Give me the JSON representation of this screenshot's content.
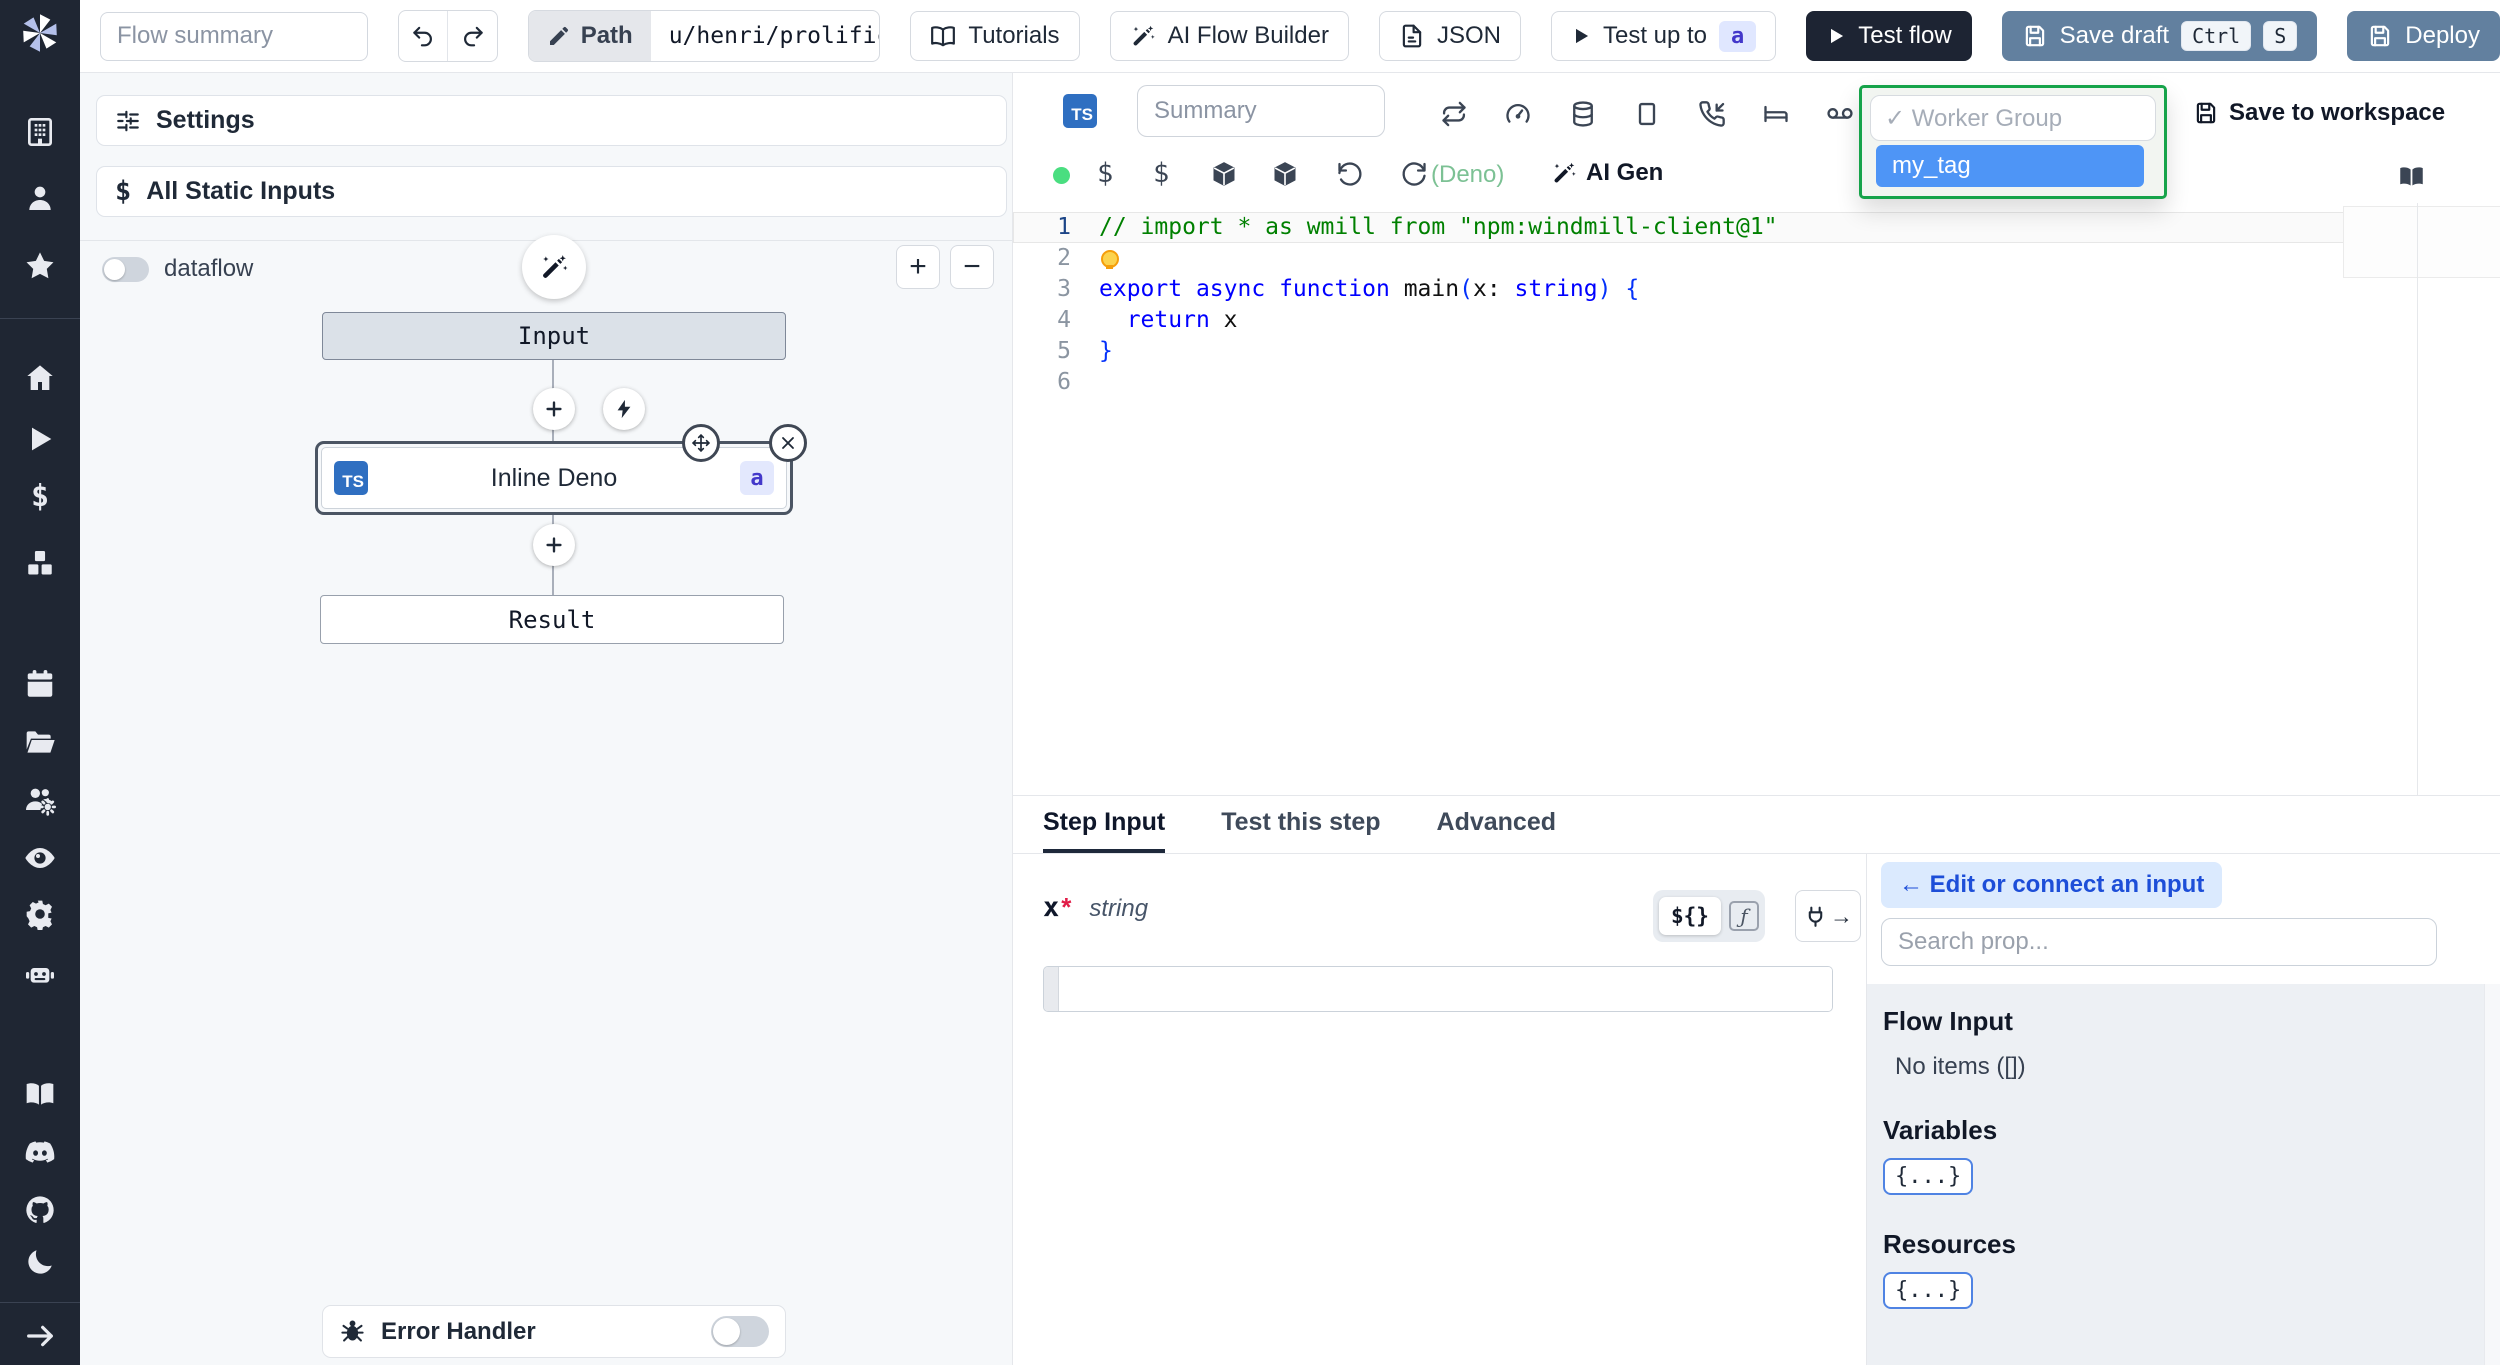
{
  "topbar": {
    "flow_summary_placeholder": "Flow summary",
    "path_label": "Path",
    "path_value": "u/henri/prolific_flow",
    "tutorials": "Tutorials",
    "ai_flow_builder": "AI Flow Builder",
    "json": "JSON",
    "test_up_to": "Test up to",
    "test_up_to_badge": "a",
    "test_flow": "Test flow",
    "save_draft": "Save draft",
    "kbd_ctrl": "Ctrl",
    "kbd_s": "S",
    "deploy": "Deploy"
  },
  "left_panel": {
    "settings": "Settings",
    "all_static_inputs": "All Static Inputs",
    "dataflow": "dataflow",
    "graph": {
      "input_node": "Input",
      "step_lang": "TS",
      "step_name": "Inline Deno",
      "step_id": "a",
      "result_node": "Result"
    },
    "error_handler": "Error Handler"
  },
  "editor": {
    "lang_badge": "TS",
    "summary_placeholder": "Summary",
    "save_to_workspace": "Save to workspace",
    "worker_group": {
      "selected": "✓ Worker Group",
      "highlighted_option": "my_tag"
    },
    "runtime": "(Deno)",
    "ai_gen": "AI Gen",
    "code_lines": [
      {
        "num": "1",
        "current": true,
        "tokens": [
          {
            "t": "// import * as wmill from \"npm:windmill-client@1\"",
            "c": "c-comment"
          }
        ]
      },
      {
        "num": "2",
        "bulb": true,
        "tokens": []
      },
      {
        "num": "3",
        "tokens": [
          {
            "t": "export",
            "c": "c-kw"
          },
          {
            "t": " ",
            "c": "c-plain"
          },
          {
            "t": "async",
            "c": "c-kw"
          },
          {
            "t": " ",
            "c": "c-plain"
          },
          {
            "t": "function",
            "c": "c-kw"
          },
          {
            "t": " main",
            "c": "c-plain"
          },
          {
            "t": "(",
            "c": "c-brace"
          },
          {
            "t": "x",
            "c": "c-plain"
          },
          {
            "t": ": ",
            "c": "c-plain"
          },
          {
            "t": "string",
            "c": "c-type"
          },
          {
            "t": ")",
            "c": "c-brace"
          },
          {
            "t": " ",
            "c": "c-plain"
          },
          {
            "t": "{",
            "c": "c-brace"
          }
        ]
      },
      {
        "num": "4",
        "tokens": [
          {
            "t": "  ",
            "c": "c-plain"
          },
          {
            "t": "return",
            "c": "c-kw"
          },
          {
            "t": " x",
            "c": "c-plain"
          }
        ]
      },
      {
        "num": "5",
        "tokens": [
          {
            "t": "}",
            "c": "c-brace"
          }
        ]
      },
      {
        "num": "6",
        "tokens": []
      }
    ]
  },
  "bottom": {
    "tabs": [
      "Step Input",
      "Test this step",
      "Advanced"
    ],
    "active_tab": "Step Input",
    "arg_name": "x",
    "arg_required": "*",
    "arg_type": "string",
    "template_chip": "${}",
    "fn_chip": "ƒ",
    "connect": {
      "edit_button": "← Edit or connect an input",
      "search_placeholder": "Search prop...",
      "flow_input": "Flow Input",
      "no_items": "No items ([])",
      "variables": "Variables",
      "variables_chip": "{...}",
      "resources": "Resources",
      "resources_chip": "{...}"
    }
  },
  "icons": {
    "sidebar": [
      "windmill-logo",
      "building",
      "person",
      "star",
      "home",
      "play",
      "dollar",
      "cubes",
      "calendar",
      "folder-open",
      "users-gear",
      "eye",
      "gear",
      "robot",
      "book",
      "discord",
      "github",
      "moon",
      "arrow-right"
    ],
    "editor_toolbar_row1": [
      "repeat",
      "gauge",
      "database",
      "square",
      "phone-incoming",
      "bed",
      "voicemail"
    ],
    "editor_toolbar_row2": [
      "status-dot",
      "dollar",
      "dollar",
      "box",
      "box",
      "rotate-ccw",
      "refresh"
    ]
  },
  "colors": {
    "sidebar_dark": "#1f2633",
    "steel_blue": "#62809f",
    "dropdown_focus_green": "#16a34a",
    "selection_blue": "#4e95f6",
    "status_green": "#4ade80",
    "badge_indigo_bg": "#e0e7ff",
    "badge_indigo_text": "#4338ca"
  }
}
